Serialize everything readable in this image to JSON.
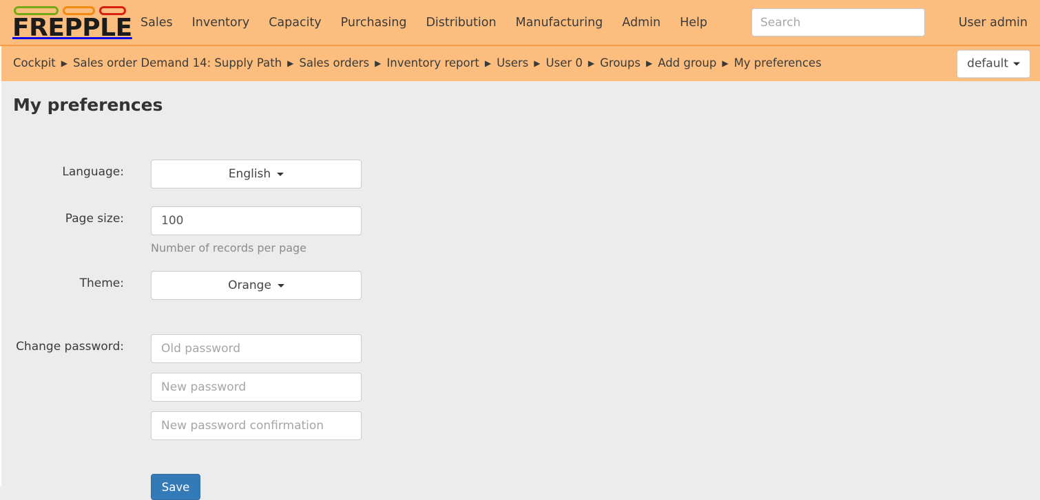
{
  "brand": {
    "name": "FREPPLE",
    "pill_colors": [
      "#76a913",
      "#f18a0e",
      "#d61f0f"
    ]
  },
  "theme_colors": {
    "header_bg": "#fcbe7f",
    "header_border": "#f79c42",
    "body_bg": "#ececec",
    "primary_button": "#337ab7"
  },
  "nav": {
    "items": [
      {
        "label": "Sales"
      },
      {
        "label": "Inventory"
      },
      {
        "label": "Capacity"
      },
      {
        "label": "Purchasing"
      },
      {
        "label": "Distribution"
      },
      {
        "label": "Manufacturing"
      },
      {
        "label": "Admin"
      },
      {
        "label": "Help"
      }
    ],
    "search": {
      "placeholder": "Search",
      "value": ""
    },
    "user": "User admin"
  },
  "breadcrumb": {
    "separator": "▶",
    "items": [
      {
        "label": "Cockpit"
      },
      {
        "label": "Sales order Demand 14: Supply Path"
      },
      {
        "label": "Sales orders"
      },
      {
        "label": "Inventory report"
      },
      {
        "label": "Users"
      },
      {
        "label": "User 0"
      },
      {
        "label": "Groups"
      },
      {
        "label": "Add group"
      },
      {
        "label": "My preferences"
      }
    ],
    "selector": {
      "label": "default"
    }
  },
  "page": {
    "title": "My preferences"
  },
  "form": {
    "language": {
      "label": "Language:",
      "value": "English"
    },
    "page_size": {
      "label": "Page size:",
      "value": "100",
      "help": "Number of records per page"
    },
    "theme": {
      "label": "Theme:",
      "value": "Orange"
    },
    "change_password": {
      "label": "Change password:",
      "old_placeholder": "Old password",
      "new_placeholder": "New password",
      "confirm_placeholder": "New password confirmation",
      "old_value": "",
      "new_value": "",
      "confirm_value": ""
    },
    "save": {
      "label": "Save"
    }
  }
}
